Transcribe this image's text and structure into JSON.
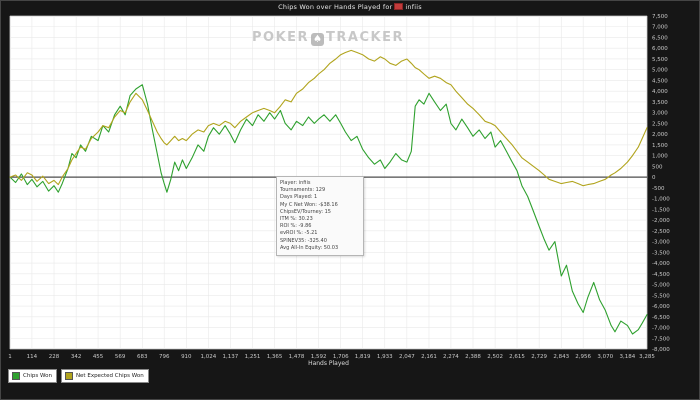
{
  "window": {
    "title_prefix": "Chips Won over Hands Played for",
    "player": "infiis"
  },
  "watermark": {
    "left": "POKER",
    "right": "TRACKER",
    "icon": "spade"
  },
  "tooltip": {
    "lines": [
      "Player: infiis",
      "Tournaments: 129",
      "Days Played: 1",
      "My C Net Won: -$38.16",
      "ChipsEV/Tourney: 15",
      "ITM %: 30.23",
      "ROI %: -9.86",
      "evROI %: -5.21",
      "SPINEV35: -325.40",
      "Avg All-In Equity: 50.03"
    ]
  },
  "legend": {
    "items": [
      {
        "label": "Chips Won",
        "color": "#2fa12f"
      },
      {
        "label": "Net Expected Chips Won",
        "color": "#b1a41d"
      }
    ]
  },
  "colors": {
    "background": "#161616",
    "plot_bg": "#ffffff",
    "grid": "#e9e9e9",
    "zero_line": "#4d4d4d",
    "axis_text": "#c9c9c9",
    "title_text": "#e6e6e6",
    "chips_won": "#2fa12f",
    "net_expected": "#b1a41d"
  },
  "chart_data": {
    "type": "line",
    "title": "Chips Won over Hands Played for infiis",
    "xlabel": "Hands Played",
    "ylabel": "",
    "xlim": [
      1,
      3285
    ],
    "ylim": [
      -8000,
      7500
    ],
    "grid": true,
    "legend_position": "bottom-left",
    "x_ticks": [
      1,
      114,
      228,
      342,
      455,
      569,
      683,
      796,
      910,
      1024,
      1137,
      1251,
      1365,
      1478,
      1592,
      1706,
      1819,
      1933,
      2047,
      2161,
      2274,
      2388,
      2502,
      2615,
      2729,
      2843,
      2956,
      3070,
      3184,
      3285
    ],
    "y_ticks": [
      7500,
      7000,
      6500,
      6000,
      5500,
      5000,
      4500,
      4000,
      3500,
      3000,
      2500,
      2000,
      1500,
      1000,
      500,
      0,
      -500,
      -1000,
      -1500,
      -2000,
      -2500,
      -3000,
      -3500,
      -4000,
      -4500,
      -5000,
      -5500,
      -6000,
      -6500,
      -7000,
      -7500,
      -8000
    ],
    "series": [
      {
        "name": "Chips Won",
        "color": "#2fa12f",
        "points": [
          [
            1,
            0
          ],
          [
            30,
            -250
          ],
          [
            60,
            150
          ],
          [
            90,
            -350
          ],
          [
            114,
            -100
          ],
          [
            140,
            -450
          ],
          [
            170,
            -200
          ],
          [
            200,
            -650
          ],
          [
            228,
            -400
          ],
          [
            250,
            -700
          ],
          [
            270,
            -300
          ],
          [
            300,
            400
          ],
          [
            320,
            1100
          ],
          [
            342,
            900
          ],
          [
            365,
            1500
          ],
          [
            390,
            1200
          ],
          [
            420,
            1900
          ],
          [
            455,
            1700
          ],
          [
            480,
            2400
          ],
          [
            510,
            2100
          ],
          [
            540,
            2900
          ],
          [
            569,
            3300
          ],
          [
            595,
            2900
          ],
          [
            620,
            3800
          ],
          [
            650,
            4100
          ],
          [
            683,
            4300
          ],
          [
            710,
            3400
          ],
          [
            735,
            2200
          ],
          [
            760,
            1100
          ],
          [
            780,
            200
          ],
          [
            796,
            -300
          ],
          [
            810,
            -700
          ],
          [
            830,
            -100
          ],
          [
            850,
            700
          ],
          [
            870,
            300
          ],
          [
            890,
            800
          ],
          [
            910,
            400
          ],
          [
            940,
            900
          ],
          [
            970,
            1500
          ],
          [
            1000,
            1200
          ],
          [
            1024,
            1900
          ],
          [
            1050,
            2300
          ],
          [
            1080,
            2000
          ],
          [
            1110,
            2400
          ],
          [
            1137,
            2000
          ],
          [
            1160,
            1600
          ],
          [
            1190,
            2200
          ],
          [
            1220,
            2700
          ],
          [
            1251,
            2400
          ],
          [
            1280,
            2900
          ],
          [
            1310,
            2600
          ],
          [
            1340,
            3000
          ],
          [
            1365,
            2700
          ],
          [
            1395,
            3100
          ],
          [
            1420,
            2500
          ],
          [
            1450,
            2200
          ],
          [
            1478,
            2600
          ],
          [
            1510,
            2400
          ],
          [
            1540,
            2800
          ],
          [
            1570,
            2500
          ],
          [
            1592,
            2700
          ],
          [
            1620,
            2900
          ],
          [
            1650,
            2600
          ],
          [
            1680,
            2900
          ],
          [
            1706,
            2500
          ],
          [
            1730,
            2100
          ],
          [
            1760,
            1700
          ],
          [
            1790,
            1900
          ],
          [
            1819,
            1300
          ],
          [
            1850,
            900
          ],
          [
            1880,
            600
          ],
          [
            1910,
            800
          ],
          [
            1933,
            400
          ],
          [
            1960,
            700
          ],
          [
            1990,
            1100
          ],
          [
            2020,
            800
          ],
          [
            2047,
            700
          ],
          [
            2070,
            1200
          ],
          [
            2090,
            3300
          ],
          [
            2110,
            3600
          ],
          [
            2135,
            3400
          ],
          [
            2161,
            3900
          ],
          [
            2190,
            3500
          ],
          [
            2220,
            3100
          ],
          [
            2250,
            3400
          ],
          [
            2274,
            2500
          ],
          [
            2300,
            2200
          ],
          [
            2330,
            2700
          ],
          [
            2360,
            2300
          ],
          [
            2388,
            1900
          ],
          [
            2420,
            2200
          ],
          [
            2450,
            1800
          ],
          [
            2480,
            2100
          ],
          [
            2502,
            1400
          ],
          [
            2530,
            1700
          ],
          [
            2560,
            1200
          ],
          [
            2590,
            700
          ],
          [
            2615,
            300
          ],
          [
            2640,
            -400
          ],
          [
            2670,
            -900
          ],
          [
            2700,
            -1600
          ],
          [
            2729,
            -2300
          ],
          [
            2755,
            -2900
          ],
          [
            2780,
            -3400
          ],
          [
            2810,
            -3000
          ],
          [
            2843,
            -4600
          ],
          [
            2870,
            -4100
          ],
          [
            2900,
            -5300
          ],
          [
            2930,
            -5900
          ],
          [
            2956,
            -6300
          ],
          [
            2980,
            -5600
          ],
          [
            3010,
            -4900
          ],
          [
            3040,
            -5700
          ],
          [
            3070,
            -6200
          ],
          [
            3100,
            -6900
          ],
          [
            3120,
            -7200
          ],
          [
            3150,
            -6700
          ],
          [
            3184,
            -6900
          ],
          [
            3210,
            -7300
          ],
          [
            3240,
            -7100
          ],
          [
            3260,
            -6800
          ],
          [
            3285,
            -6400
          ]
        ]
      },
      {
        "name": "Net Expected Chips Won",
        "color": "#b1a41d",
        "points": [
          [
            1,
            0
          ],
          [
            30,
            100
          ],
          [
            60,
            -150
          ],
          [
            90,
            200
          ],
          [
            114,
            100
          ],
          [
            140,
            -200
          ],
          [
            170,
            50
          ],
          [
            200,
            -300
          ],
          [
            228,
            -150
          ],
          [
            250,
            -350
          ],
          [
            270,
            0
          ],
          [
            300,
            400
          ],
          [
            320,
            800
          ],
          [
            342,
            1100
          ],
          [
            365,
            1400
          ],
          [
            390,
            1300
          ],
          [
            420,
            1800
          ],
          [
            455,
            2100
          ],
          [
            480,
            2400
          ],
          [
            510,
            2300
          ],
          [
            540,
            2800
          ],
          [
            569,
            3100
          ],
          [
            595,
            3000
          ],
          [
            620,
            3500
          ],
          [
            650,
            3900
          ],
          [
            683,
            3600
          ],
          [
            710,
            3100
          ],
          [
            735,
            2600
          ],
          [
            760,
            2100
          ],
          [
            780,
            1800
          ],
          [
            796,
            1600
          ],
          [
            810,
            1500
          ],
          [
            830,
            1700
          ],
          [
            850,
            1900
          ],
          [
            870,
            1700
          ],
          [
            890,
            1800
          ],
          [
            910,
            1700
          ],
          [
            940,
            2000
          ],
          [
            970,
            2200
          ],
          [
            1000,
            2100
          ],
          [
            1024,
            2400
          ],
          [
            1050,
            2500
          ],
          [
            1080,
            2400
          ],
          [
            1110,
            2600
          ],
          [
            1137,
            2500
          ],
          [
            1160,
            2300
          ],
          [
            1190,
            2600
          ],
          [
            1220,
            2800
          ],
          [
            1251,
            3000
          ],
          [
            1280,
            3100
          ],
          [
            1310,
            3200
          ],
          [
            1340,
            3100
          ],
          [
            1365,
            3000
          ],
          [
            1395,
            3300
          ],
          [
            1420,
            3600
          ],
          [
            1450,
            3500
          ],
          [
            1478,
            3900
          ],
          [
            1510,
            4100
          ],
          [
            1540,
            4400
          ],
          [
            1570,
            4600
          ],
          [
            1592,
            4800
          ],
          [
            1620,
            5000
          ],
          [
            1650,
            5300
          ],
          [
            1680,
            5500
          ],
          [
            1706,
            5700
          ],
          [
            1730,
            5800
          ],
          [
            1760,
            5900
          ],
          [
            1790,
            5800
          ],
          [
            1819,
            5700
          ],
          [
            1850,
            5500
          ],
          [
            1880,
            5400
          ],
          [
            1910,
            5600
          ],
          [
            1933,
            5500
          ],
          [
            1960,
            5300
          ],
          [
            1990,
            5200
          ],
          [
            2020,
            5400
          ],
          [
            2047,
            5500
          ],
          [
            2070,
            5300
          ],
          [
            2090,
            5100
          ],
          [
            2110,
            5000
          ],
          [
            2135,
            4800
          ],
          [
            2161,
            4600
          ],
          [
            2190,
            4700
          ],
          [
            2220,
            4600
          ],
          [
            2250,
            4400
          ],
          [
            2274,
            4300
          ],
          [
            2300,
            4000
          ],
          [
            2330,
            3700
          ],
          [
            2360,
            3400
          ],
          [
            2388,
            3200
          ],
          [
            2420,
            2900
          ],
          [
            2450,
            2600
          ],
          [
            2480,
            2500
          ],
          [
            2502,
            2400
          ],
          [
            2530,
            2100
          ],
          [
            2560,
            1800
          ],
          [
            2590,
            1500
          ],
          [
            2615,
            1200
          ],
          [
            2640,
            900
          ],
          [
            2670,
            700
          ],
          [
            2700,
            500
          ],
          [
            2729,
            300
          ],
          [
            2755,
            100
          ],
          [
            2780,
            -100
          ],
          [
            2810,
            -200
          ],
          [
            2843,
            -300
          ],
          [
            2870,
            -250
          ],
          [
            2900,
            -200
          ],
          [
            2930,
            -300
          ],
          [
            2956,
            -400
          ],
          [
            2980,
            -350
          ],
          [
            3010,
            -300
          ],
          [
            3040,
            -200
          ],
          [
            3070,
            -100
          ],
          [
            3100,
            100
          ],
          [
            3120,
            200
          ],
          [
            3150,
            400
          ],
          [
            3184,
            700
          ],
          [
            3210,
            1000
          ],
          [
            3240,
            1400
          ],
          [
            3260,
            1800
          ],
          [
            3285,
            2300
          ]
        ]
      }
    ]
  }
}
